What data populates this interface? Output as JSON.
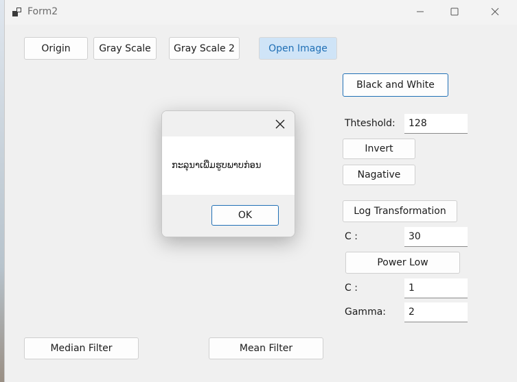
{
  "window": {
    "title": "Form2"
  },
  "toolbar": {
    "origin_label": "Origin",
    "grayscale_label": "Gray Scale",
    "grayscale2_label": "Gray Scale 2",
    "open_image_label": "Open Image"
  },
  "right_panel": {
    "black_white_label": "Black and White",
    "threshold_label": "Thteshold:",
    "threshold_value": "128",
    "invert_label": "Invert",
    "negative_label": "Nagative",
    "log_label": "Log Transformation",
    "log_c_label": "C :",
    "log_c_value": "30",
    "power_label": "Power Low",
    "power_c_label": "C :",
    "power_c_value": "1",
    "gamma_label": "Gamma:",
    "gamma_value": "2"
  },
  "bottom": {
    "median_label": "Median Filter",
    "mean_label": "Mean Filter"
  },
  "dialog": {
    "message": "ກະລຸນາເພີ່ມຮູບພາບກ່ອນ",
    "ok_label": "OK"
  }
}
